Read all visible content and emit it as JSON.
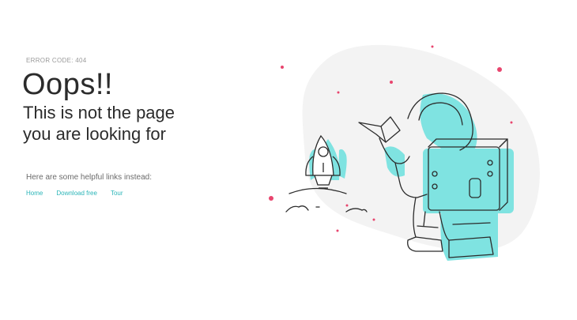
{
  "error": {
    "code_label": "ERROR CODE: 404",
    "title": "Oops!!",
    "subtitle_line1": "This is not the page",
    "subtitle_line2": "you are looking for"
  },
  "helpful": {
    "text": "Here are some helpful links instead:",
    "links": [
      {
        "label": "Home"
      },
      {
        "label": "Download free"
      },
      {
        "label": "Tour"
      }
    ]
  },
  "colors": {
    "accent": "#7fe3e1",
    "link": "#2bb5b8",
    "star": "#e8456e",
    "blob": "#f3f3f3",
    "outline": "#2b2b2b"
  },
  "illustration": {
    "icons": [
      "astronaut-icon",
      "rocket-icon",
      "star-icon"
    ]
  }
}
